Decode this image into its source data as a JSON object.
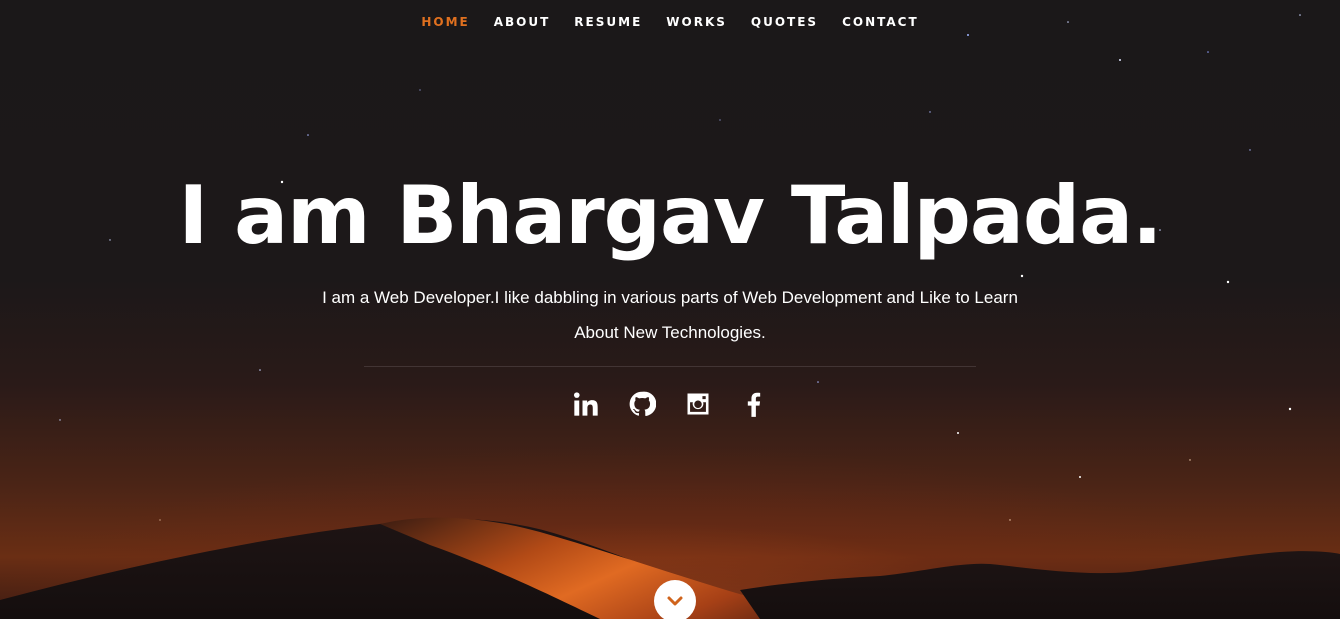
{
  "nav": {
    "items": [
      {
        "label": "HOME",
        "active": true
      },
      {
        "label": "ABOUT",
        "active": false
      },
      {
        "label": "RESUME",
        "active": false
      },
      {
        "label": "WORKS",
        "active": false
      },
      {
        "label": "QUOTES",
        "active": false
      },
      {
        "label": "CONTACT",
        "active": false
      }
    ]
  },
  "banner": {
    "title": "I am Bhargav Talpada.",
    "subtitle": "I am a Web Developer.I like dabbling in various parts of Web Development and Like to Learn About New Technologies."
  },
  "social": [
    {
      "icon": "linkedin-icon"
    },
    {
      "icon": "github-icon"
    },
    {
      "icon": "instagram-icon"
    },
    {
      "icon": "facebook-icon"
    }
  ],
  "scroll": {
    "icon": "chevron-down-icon"
  },
  "colors": {
    "accent": "#e0701f",
    "text": "#ffffff",
    "background": "#1a1718"
  }
}
